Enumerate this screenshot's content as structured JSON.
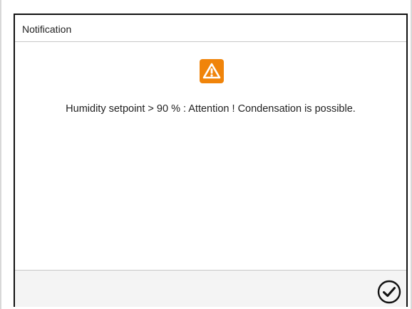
{
  "dialog": {
    "title": "Notification",
    "message": "Humidity setpoint > 90 % : Attention ! Condensation is possible.",
    "icon": "warning-icon",
    "confirm_icon": "check-circle-icon"
  },
  "colors": {
    "warning": "#f0840a",
    "border": "#111111",
    "footer_bg": "#f4f4f4"
  }
}
